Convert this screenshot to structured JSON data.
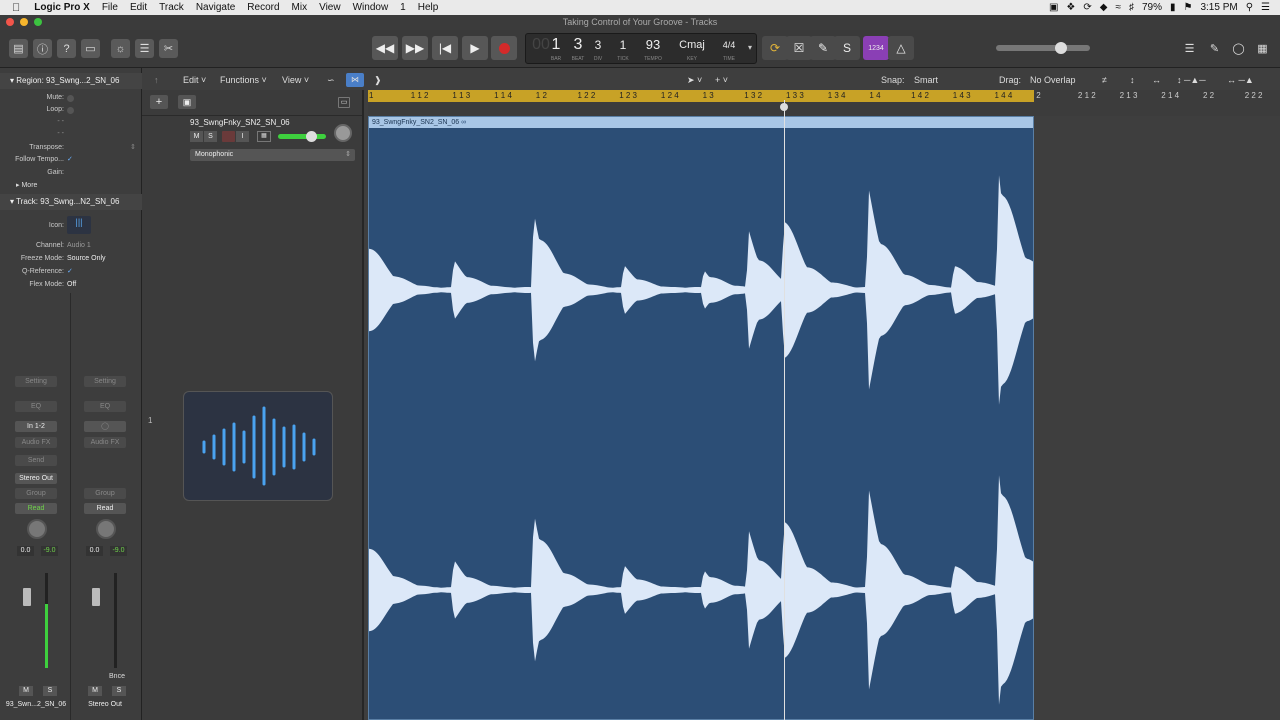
{
  "menubar": {
    "app": "Logic Pro X",
    "items": [
      "File",
      "Edit",
      "Track",
      "Navigate",
      "Record",
      "Mix",
      "View",
      "Window",
      "1",
      "Help"
    ],
    "battery": "79%",
    "time": "3:15 PM"
  },
  "window": {
    "title": "Taking Control of Your Groove - Tracks"
  },
  "lcd": {
    "bar": "1",
    "beat": "3",
    "div": "3",
    "tick": "1",
    "bar_label": "BAR",
    "beat_label": "BEAT",
    "div_label": "DIV",
    "tick_label": "TICK",
    "tempo": "93",
    "tempo_label": "TEMPO",
    "key": "Cmaj",
    "key_label": "KEY",
    "time_sig": "4/4",
    "time_label": "TIME"
  },
  "control": {
    "count_in": "1234"
  },
  "inspector": {
    "region_header": "Region: 93_Swng...2_SN_06",
    "mute": "Mute:",
    "loop": "Loop:",
    "dash1": "-  -",
    "dash2": "-  -",
    "transpose": "Transpose:",
    "follow_tempo": "Follow Tempo...",
    "gain": "Gain:",
    "more": "More",
    "track_header": "Track: 93_Swng...N2_SN_06",
    "icon_label": "Icon:",
    "channel_label": "Channel:",
    "channel_value": "Audio 1",
    "freeze_label": "Freeze Mode:",
    "freeze_value": "Source Only",
    "qref_label": "Q-Reference:",
    "flex_label": "Flex Mode:",
    "flex_value": "Off"
  },
  "strips": [
    {
      "setting": "Setting",
      "eq": "EQ",
      "input": "In 1-2",
      "audio_fx": "Audio FX",
      "send": "Send",
      "output": "Stereo Out",
      "group": "Group",
      "read": "Read",
      "pan_val": "0.0",
      "level": "-9.0",
      "m": "M",
      "s": "S",
      "name": "93_Swn...2_SN_06"
    },
    {
      "setting": "Setting",
      "eq": "EQ",
      "input": "",
      "audio_fx": "Audio FX",
      "send": "",
      "output": "",
      "group": "Group",
      "read": "Read",
      "pan_val": "0.0",
      "level": "-9.0",
      "m": "M",
      "s": "S",
      "bnce": "Bnce",
      "name": "Stereo Out"
    }
  ],
  "tracks_toolbar": {
    "edit": "Edit",
    "functions": "Functions",
    "view": "View",
    "snap_label": "Snap:",
    "snap_value": "Smart",
    "drag_label": "Drag:",
    "drag_value": "No Overlap"
  },
  "track": {
    "number": "1",
    "name": "93_SwngFnky_SN2_SN_06",
    "mute": "M",
    "solo": "S",
    "input_mon": "I",
    "flex_mode": "Monophonic"
  },
  "ruler": {
    "ticks": [
      "1",
      "1 1 2",
      "1 1 3",
      "1 1 4",
      "1 2",
      "1 2 2",
      "1 2 3",
      "1 2 4",
      "1 3",
      "1 3 2",
      "1 3 3",
      "1 3 4",
      "1 4",
      "1 4 2",
      "1 4 3",
      "1 4 4",
      "2",
      "2 1 2",
      "2 1 3",
      "2 1 4",
      "2 2",
      "2 2 2"
    ]
  },
  "region": {
    "name": "93_SwngFnky_SN2_SN_06"
  },
  "colors": {
    "region_bg": "#2c4e76",
    "waveform": "#dce8f8",
    "cycle": "#c8a226",
    "record": "#d42a2a",
    "accent_purple": "#8a3fb5"
  }
}
